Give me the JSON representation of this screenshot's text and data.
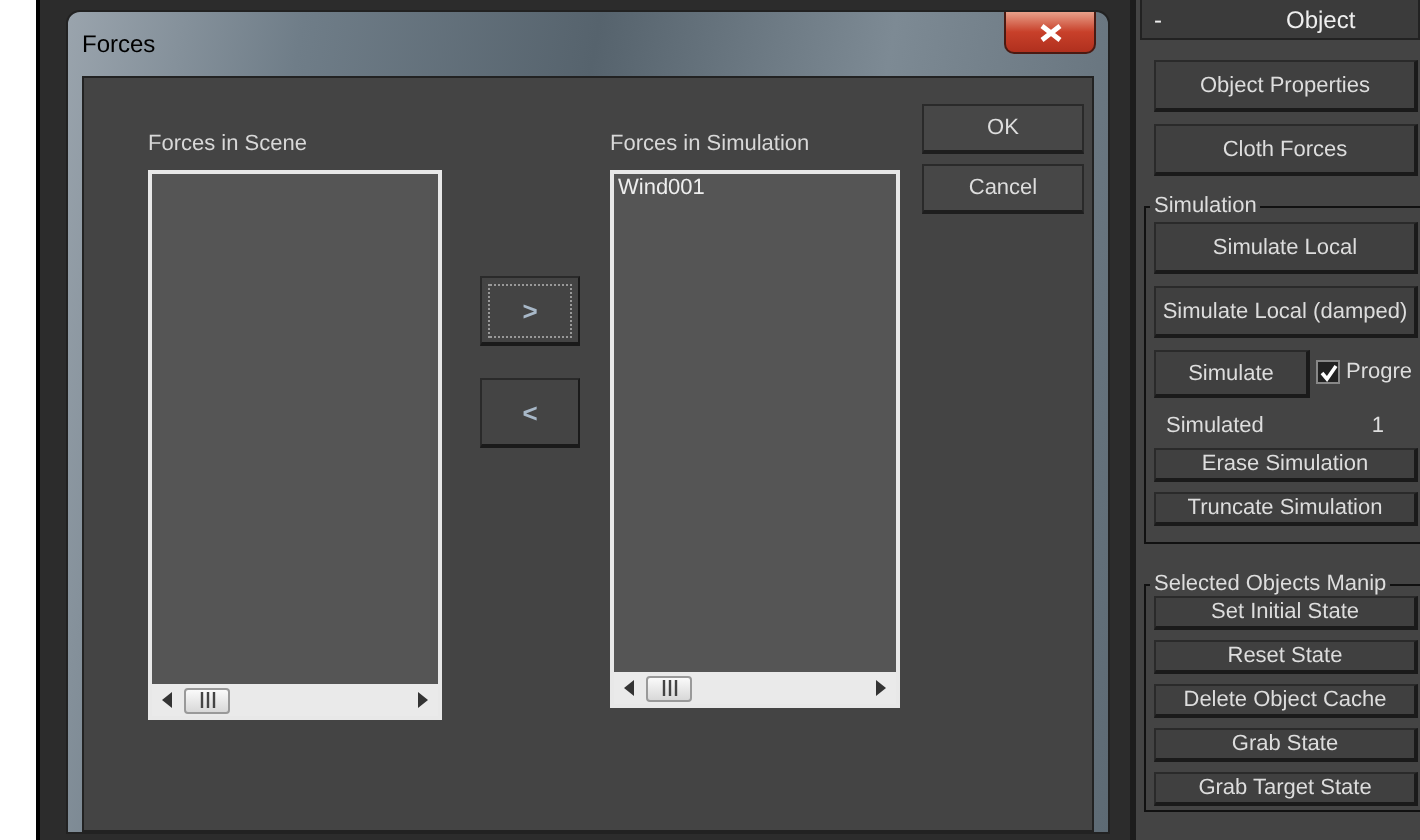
{
  "dialog": {
    "title": "Forces",
    "scene_list": {
      "label": "Forces in Scene"
    },
    "simulation_list": {
      "label": "Forces in Simulation",
      "items": [
        {
          "text": "Wind001",
          "selected": false
        }
      ]
    },
    "move_buttons": [
      {
        "label": ">",
        "focused": true
      },
      {
        "label": "<",
        "focused": false
      }
    ],
    "buttons": [
      "OK",
      "Cancel"
    ]
  },
  "panel": {
    "collapse_glyph": "-",
    "title": "Object",
    "top_buttons": [
      "Object Properties",
      "Cloth Forces"
    ],
    "simulation": {
      "title": "Simulation",
      "rows": [
        {
          "kind": "button",
          "label": "Simulate Local"
        },
        {
          "kind": "button",
          "label": "Simulate Local (damped)"
        },
        {
          "kind": "button_check",
          "label": "Simulate",
          "check_label": "Progre",
          "checked": true
        },
        {
          "kind": "readout",
          "label": "Simulated",
          "value": "1"
        },
        {
          "kind": "small_button",
          "label": "Erase Simulation"
        },
        {
          "kind": "small_button",
          "label": "Truncate Simulation"
        }
      ]
    },
    "manip": {
      "title": "Selected Objects Manip",
      "buttons": [
        "Set Initial State",
        "Reset State",
        "Delete Object Cache",
        "Grab State",
        "Grab Target State"
      ]
    }
  }
}
